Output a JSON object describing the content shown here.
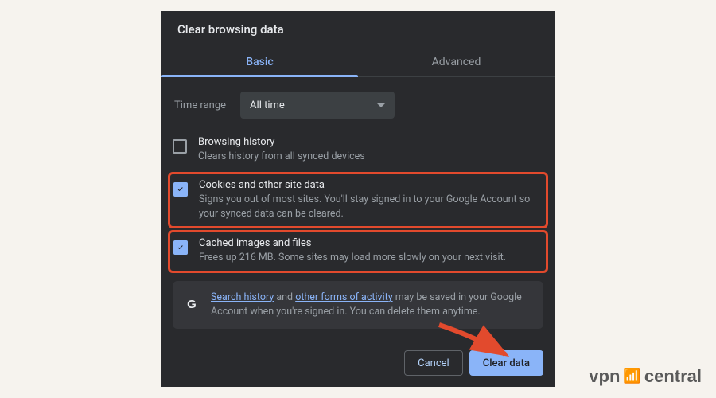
{
  "dialog": {
    "title": "Clear browsing data",
    "tabs": {
      "basic": "Basic",
      "advanced": "Advanced"
    },
    "time_range": {
      "label": "Time range",
      "value": "All time"
    },
    "options": [
      {
        "label": "Browsing history",
        "desc": "Clears history from all synced devices",
        "checked": false
      },
      {
        "label": "Cookies and other site data",
        "desc": "Signs you out of most sites. You'll stay signed in to your Google Account so your synced data can be cleared.",
        "checked": true
      },
      {
        "label": "Cached images and files",
        "desc": "Frees up 216 MB. Some sites may load more slowly on your next visit.",
        "checked": true
      }
    ],
    "info": {
      "link1": "Search history",
      "mid1": " and ",
      "link2": "other forms of activity",
      "tail": " may be saved in your Google Account when you're signed in. You can delete them anytime."
    },
    "buttons": {
      "cancel": "Cancel",
      "clear": "Clear data"
    }
  },
  "watermark": {
    "pre": "vpn",
    "post": "central"
  }
}
